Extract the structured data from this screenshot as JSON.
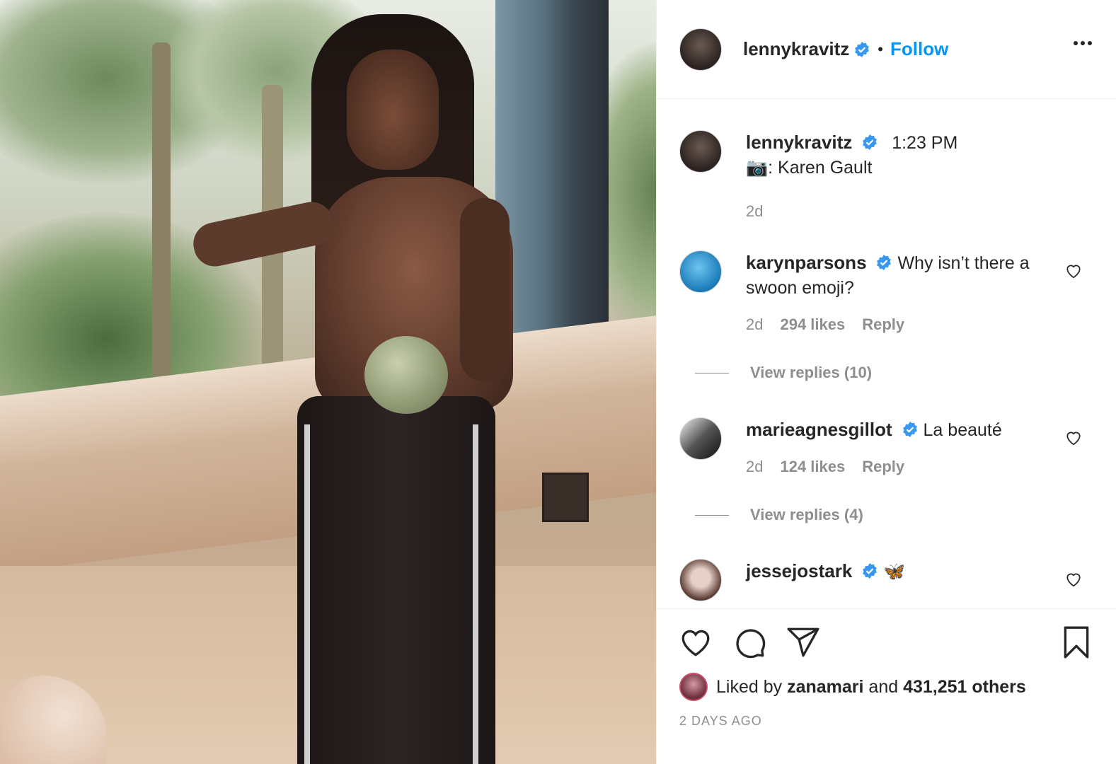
{
  "header": {
    "username": "lennykravitz",
    "separator": "•",
    "follow_label": "Follow"
  },
  "caption": {
    "username": "lennykravitz",
    "time": "1:23 PM",
    "camera_emoji": "📷",
    "text": ": Karen Gault",
    "age": "2d"
  },
  "comments": [
    {
      "username": "karynparsons",
      "text": "Why isn’t there a swoon emoji?",
      "age": "2d",
      "likes": "294 likes",
      "reply_label": "Reply",
      "view_replies": "View replies (10)"
    },
    {
      "username": "marieagnesgillot",
      "text": "La beauté",
      "age": "2d",
      "likes": "124 likes",
      "reply_label": "Reply",
      "view_replies": "View replies (4)"
    },
    {
      "username": "jessejostark",
      "text": "🦋"
    }
  ],
  "likes": {
    "prefix": "Liked by",
    "user": "zanamari",
    "middle": "and",
    "count": "431,251 others"
  },
  "timestamp": "2 DAYS AGO",
  "colors": {
    "accent": "#0095f6",
    "secondary_text": "#8e8e8e",
    "primary_text": "#262626",
    "verified": "#3897f0"
  },
  "icons": [
    "verified-badge-icon",
    "more-options-icon",
    "heart-icon",
    "comment-icon",
    "share-icon",
    "bookmark-icon",
    "heart-small-icon"
  ]
}
